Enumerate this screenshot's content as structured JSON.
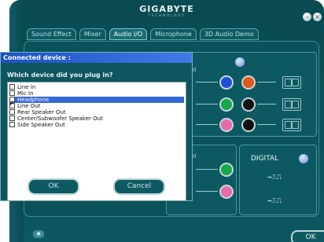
{
  "app": {
    "brand_name": "GIGABYTE",
    "brand_sub": "TECHNOLOGY",
    "tabs": [
      {
        "label": "Sound Effect"
      },
      {
        "label": "Mixer"
      },
      {
        "label": "Audio I/O"
      },
      {
        "label": "Microphone"
      },
      {
        "label": "3D Audio Demo"
      }
    ],
    "active_tab": "Audio I/O",
    "panel_label_1": "el",
    "panel_label_2": "el",
    "digital_label": "DIGITAL",
    "wave_symbol": "→⎍⎍",
    "ok_label": "OK"
  },
  "dialog": {
    "title": "Connected device :",
    "question": "Which device did you plug in?",
    "items": [
      {
        "label": "Line In",
        "checked": false
      },
      {
        "label": "Mic In",
        "checked": false
      },
      {
        "label": "Headphone",
        "checked": false
      },
      {
        "label": "Line Out",
        "checked": true
      },
      {
        "label": "Rear Speaker Out",
        "checked": false
      },
      {
        "label": "Center/Subwoofer Speaker Out",
        "checked": false
      },
      {
        "label": "Side Speaker Out",
        "checked": false
      }
    ],
    "selected_item": "Headphone",
    "ok_label": "OK",
    "cancel_label": "Cancel"
  },
  "colors": {
    "jack_blue": "#1e4fd8",
    "jack_orange": "#e05a1a",
    "jack_green": "#16a84a",
    "jack_black": "#111111",
    "jack_pink": "#e86aa8",
    "selection": "#3468d6"
  }
}
